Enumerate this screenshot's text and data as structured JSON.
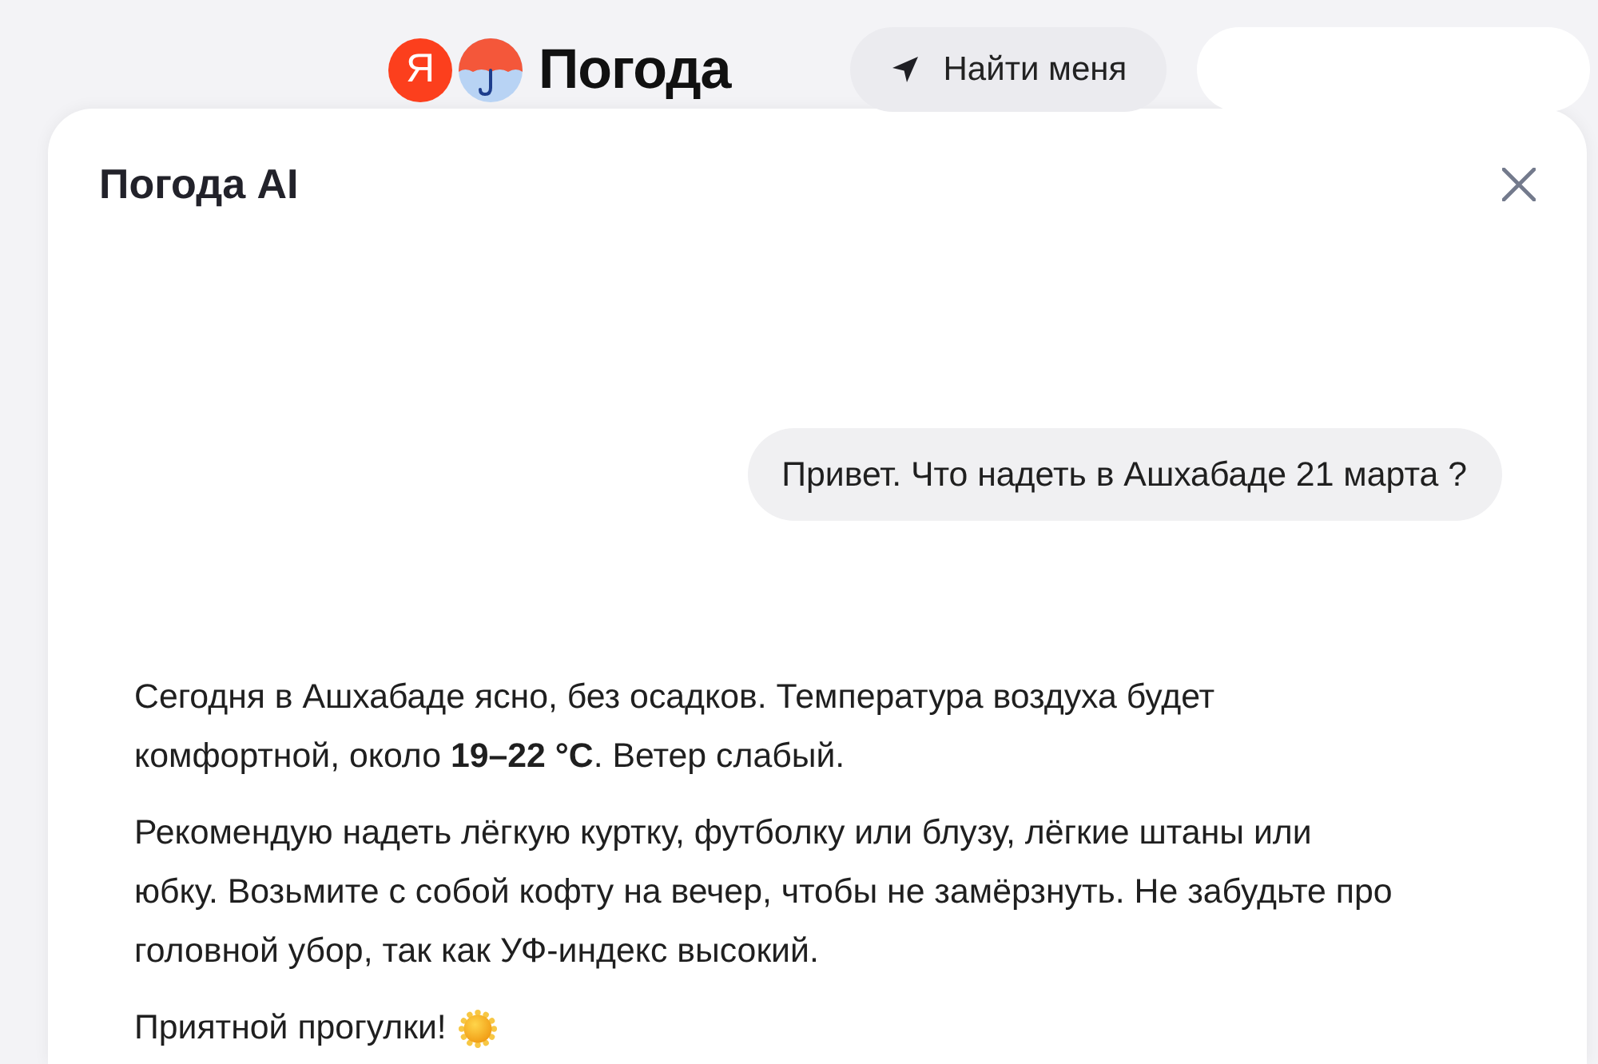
{
  "header": {
    "logo": {
      "badge": "Я",
      "name": "Погода"
    },
    "locate_button": {
      "label": "Найти меня"
    }
  },
  "panel": {
    "title": "Погода AI",
    "messages": [
      {
        "kind": "user",
        "text": "Привет. Что надеть в Ашхабаде 21 марта ?"
      },
      {
        "kind": "assistant",
        "paragraphs": [
          "Сегодня в Ашхабаде ясно, без осадков. Температура воздуха будет комфортной, около **19–22 °C**. Ветер слабый.",
          "Рекомендую надеть лёгкую куртку, футболку или блузу, лёгкие штаны или юбку. Возьмите с собой кофту на вечер, чтобы не замёрзнуть. Не забудьте про головной убор, так как УФ-индекс высокий."
        ],
        "closing": "Приятной прогулки!"
      }
    ]
  }
}
